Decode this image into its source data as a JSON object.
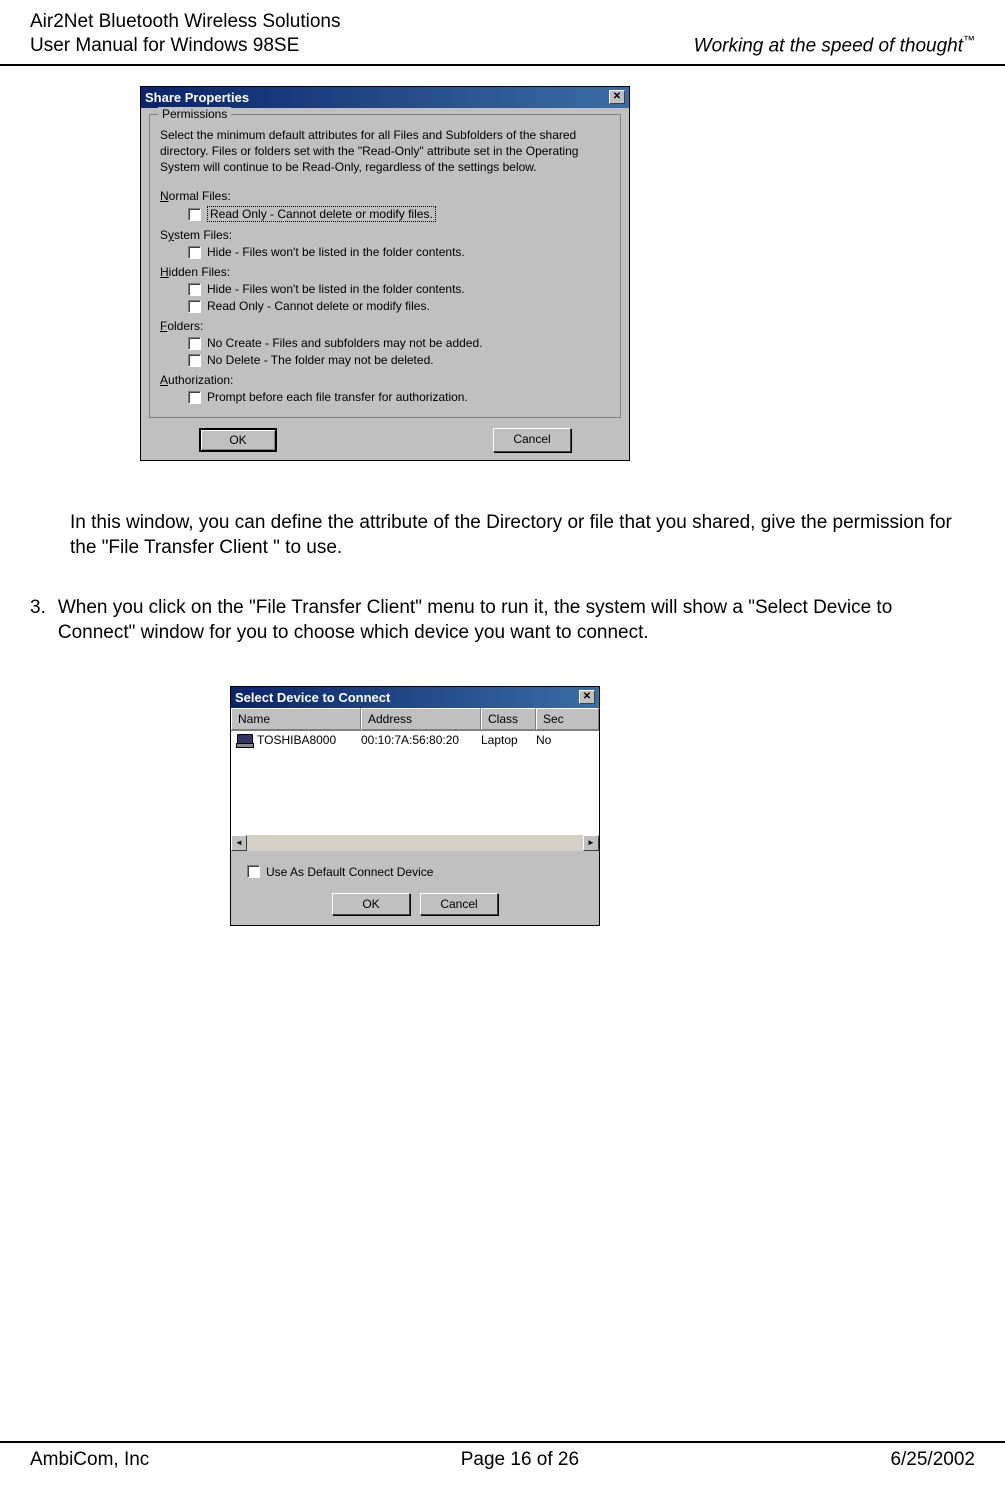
{
  "header": {
    "line1": "Air2Net Bluetooth Wireless Solutions",
    "line2": "User Manual for Windows 98SE",
    "right": "Working at the speed of thought",
    "tm": "™"
  },
  "dialog1": {
    "title": "Share Properties",
    "group": "Permissions",
    "description": "Select the minimum default attributes for all Files and Subfolders of the shared directory.  Files or folders set with the \"Read-Only\" attribute set in the Operating System will continue to be Read-Only, regardless of the settings below.",
    "normal": {
      "label": "Normal Files:",
      "opt1": "Read Only - Cannot delete or modify files."
    },
    "system": {
      "label": "System Files:",
      "opt1": "Hide - Files won't be listed in the folder contents."
    },
    "hidden": {
      "label": "Hidden Files:",
      "opt1": "Hide - Files won't be listed in the folder contents.",
      "opt2": "Read Only - Cannot delete or modify files."
    },
    "folders": {
      "label": "Folders:",
      "opt1": "No Create - Files and subfolders may not be added.",
      "opt2": "No Delete - The folder may not be deleted."
    },
    "auth": {
      "label": "Authorization:",
      "opt1": "Prompt before each file transfer for authorization."
    },
    "ok": "OK",
    "cancel": "Cancel"
  },
  "paragraph1": "In this window, you can define the attribute of the Directory or file that you shared, give the permission for the \"File Transfer Client \" to use.",
  "paragraph2_num": "3.",
  "paragraph2": "When you click on the \"File Transfer Client\" menu to run it, the system will show a \"Select Device to Connect\" window for you to choose which device you want to connect.",
  "dialog2": {
    "title": "Select Device to Connect",
    "cols": {
      "name": "Name",
      "address": "Address",
      "class": "Class",
      "sec": "Sec"
    },
    "row": {
      "name": "TOSHIBA8000",
      "address": "00:10:7A:56:80:20",
      "class": "Laptop",
      "sec": "No"
    },
    "default_label": "Use As Default Connect Device",
    "ok": "OK",
    "cancel": "Cancel"
  },
  "footer": {
    "left": "AmbiCom, Inc",
    "center": "Page 16 of 26",
    "right": "6/25/2002"
  }
}
